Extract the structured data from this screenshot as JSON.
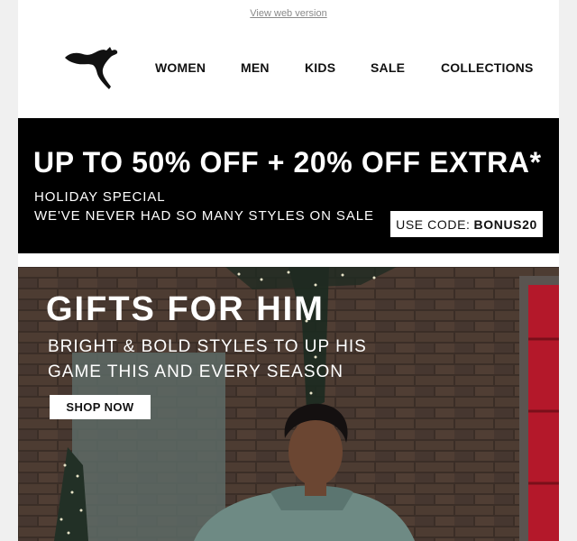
{
  "header": {
    "view_web_version": "View web version",
    "logo_icon": "puma-cat-logo-icon",
    "nav": [
      "WOMEN",
      "MEN",
      "KIDS",
      "SALE",
      "COLLECTIONS"
    ]
  },
  "promo": {
    "headline": "UP TO 50% OFF + 20% OFF EXTRA*",
    "line1": "HOLIDAY SPECIAL",
    "line2": "WE'VE NEVER HAD SO MANY STYLES ON SALE",
    "code_label": "USE CODE:",
    "code_value": "BONUS20"
  },
  "hero": {
    "title": "GIFTS FOR HIM",
    "subtitle_line1": "BRIGHT & BOLD STYLES TO UP HIS",
    "subtitle_line2": "GAME THIS AND EVERY SEASON",
    "cta": "SHOP NOW"
  },
  "colors": {
    "background": "#f0f0f0",
    "banner": "#000000",
    "brick": "#4a3a31",
    "door_red": "#b4182a",
    "hoodie": "#6e8a84"
  }
}
